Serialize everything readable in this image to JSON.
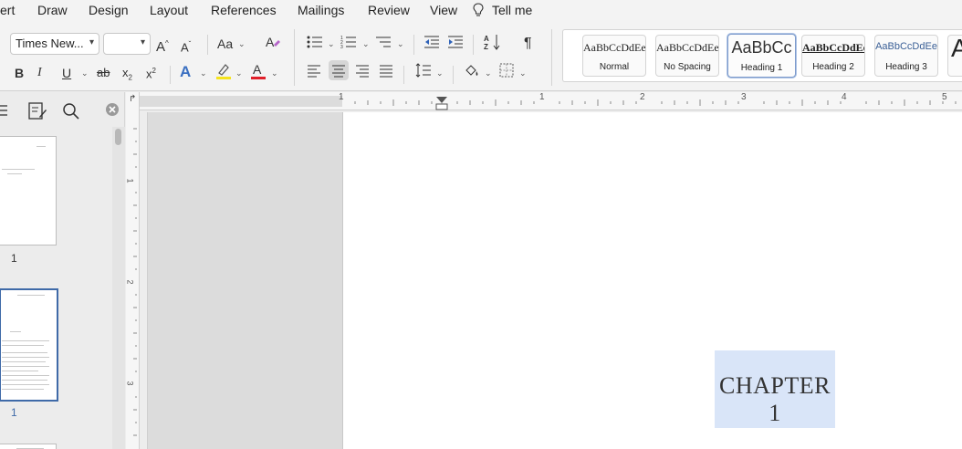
{
  "menu": {
    "items": [
      "ert",
      "Draw",
      "Design",
      "Layout",
      "References",
      "Mailings",
      "Review",
      "View",
      "Tell me"
    ]
  },
  "font": {
    "name": "Times New...",
    "size": ""
  },
  "styles": [
    {
      "preview": "AaBbCcDdEe",
      "name": "Normal"
    },
    {
      "preview": "AaBbCcDdEe",
      "name": "No Spacing"
    },
    {
      "preview": "AaBbCc",
      "name": "Heading 1"
    },
    {
      "preview": "AaBbCcDdEe",
      "name": "Heading 2"
    },
    {
      "preview": "AaBbCcDdEe",
      "name": "Heading 3"
    },
    {
      "preview": "A",
      "name": ""
    }
  ],
  "selected_style": "Heading 1",
  "thumbnails": [
    {
      "page_label": "1"
    },
    {
      "page_label": "1"
    }
  ],
  "ruler": {
    "h_labels": [
      "1",
      "1",
      "2",
      "3",
      "4",
      "5"
    ],
    "v_labels": [
      "1",
      "2",
      "3"
    ]
  },
  "document": {
    "heading": "CHAPTER 1"
  },
  "colors": {
    "highlight": "#f5e31d",
    "font_color": "#e0202a",
    "text_effects": "#3a6fc1",
    "selection": "#d9e5f8",
    "thumb_selected_border": "#3f6aa8",
    "page_num_selected": "#3f6aa8"
  }
}
